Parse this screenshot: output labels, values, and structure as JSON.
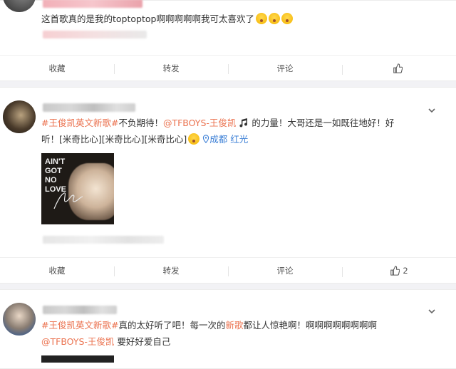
{
  "posts": [
    {
      "text_main": "这首歌真的是我的toptoptop啊啊啊啊啊我可太喜欢了",
      "emojis": [
        "surprised-emoji",
        "surprised-emoji",
        "surprised-emoji"
      ],
      "actions": {
        "favorite": "收藏",
        "repost": "转发",
        "comment": "评论",
        "like_count": ""
      }
    },
    {
      "hashtag": "#王俊凯英文新歌#",
      "text_a": "不负期待！",
      "mention": "@TFBOYS-王俊凯",
      "text_b": " 的力量！大哥还是一如既往地好！好听！[米奇比心][米奇比心][米奇比心]",
      "location": "成都",
      "location_extra": "红光",
      "image_text": {
        "line1": "AIN'T",
        "line2": "GOT",
        "line3": "NO",
        "line4": "LOVE"
      },
      "actions": {
        "favorite": "收藏",
        "repost": "转发",
        "comment": "评论",
        "like_count": "2"
      }
    },
    {
      "hashtag": "#王俊凯英文新歌#",
      "text_a": "真的太好听了吧！每一次的",
      "highlight": "新歌",
      "text_b": "都让人惊艳啊！啊啊啊啊啊啊啊啊",
      "mention": "@TFBOYS-王俊凯",
      "text_c": " 要好好爱自己"
    }
  ],
  "colors": {
    "link": "#eb7350",
    "location": "#3b7fd6",
    "background": "#f2f2f5"
  }
}
